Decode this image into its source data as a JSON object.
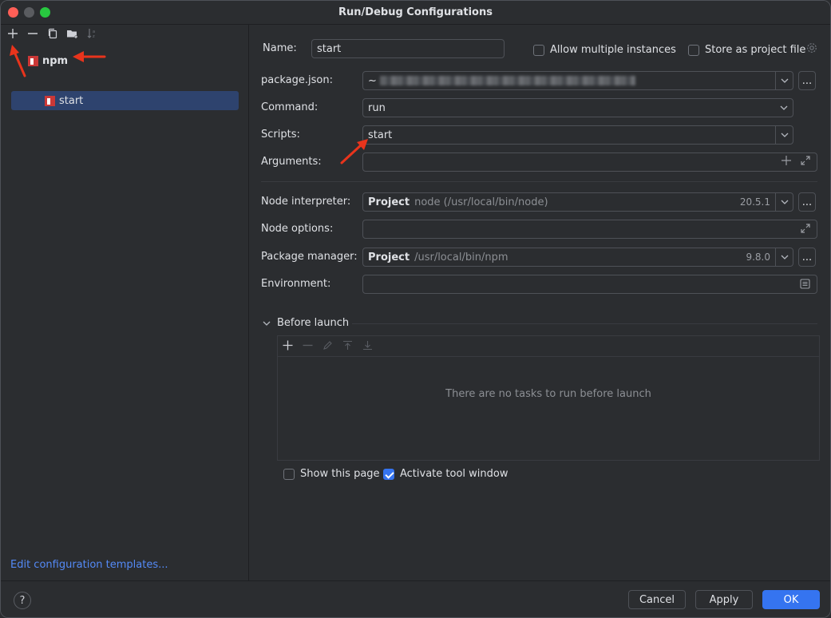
{
  "window": {
    "title": "Run/Debug Configurations"
  },
  "sidebar": {
    "toolbar": [
      "add-icon",
      "remove-icon",
      "copy-icon",
      "new-folder-icon",
      "sort-icon"
    ],
    "tree": {
      "group_label": "npm",
      "items": [
        {
          "label": "start",
          "selected": true
        }
      ]
    },
    "edit_templates_link": "Edit configuration templates..."
  },
  "form": {
    "name": {
      "label": "Name:",
      "value": "start"
    },
    "allow_multiple": {
      "label": "Allow multiple instances",
      "checked": false
    },
    "store_as_project": {
      "label": "Store as project file",
      "checked": false
    },
    "package_json": {
      "label": "package.json:",
      "value": "~"
    },
    "command": {
      "label": "Command:",
      "value": "run"
    },
    "scripts": {
      "label": "Scripts:",
      "value": "start"
    },
    "arguments": {
      "label": "Arguments:",
      "value": ""
    },
    "node_interpreter": {
      "label": "Node interpreter:",
      "prefix": "Project",
      "value": "node (/usr/local/bin/node)",
      "version": "20.5.1"
    },
    "node_options": {
      "label": "Node options:",
      "value": ""
    },
    "package_manager": {
      "label": "Package manager:",
      "prefix": "Project",
      "value": "/usr/local/bin/npm",
      "version": "9.8.0"
    },
    "environment": {
      "label": "Environment:",
      "value": ""
    },
    "browse_label": "..."
  },
  "before_launch": {
    "title": "Before launch",
    "empty_message": "There are no tasks to run before launch",
    "show_this_page": {
      "label": "Show this page",
      "checked": false
    },
    "activate_tool_window": {
      "label": "Activate tool window",
      "checked": true
    }
  },
  "footer": {
    "help": "?",
    "cancel": "Cancel",
    "apply": "Apply",
    "ok": "OK"
  },
  "colors": {
    "accent": "#3574f0",
    "annotation_arrow": "#e8341c",
    "npm": "#cb3837"
  }
}
